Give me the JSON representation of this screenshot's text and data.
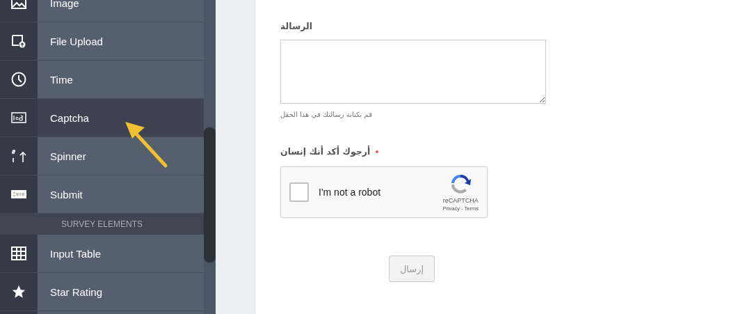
{
  "sidebar": {
    "items": [
      {
        "kind": "element",
        "label": "Image",
        "selected": false
      },
      {
        "kind": "element",
        "label": "File Upload",
        "selected": false
      },
      {
        "kind": "element",
        "label": "Time",
        "selected": false
      },
      {
        "kind": "element",
        "label": "Captcha",
        "selected": true
      },
      {
        "kind": "element",
        "label": "Spinner",
        "selected": false
      },
      {
        "kind": "element",
        "label": "Submit",
        "selected": false
      },
      {
        "kind": "section",
        "label": "SURVEY ELEMENTS"
      },
      {
        "kind": "element",
        "label": "Input Table",
        "selected": false
      },
      {
        "kind": "element",
        "label": "Star Rating",
        "selected": false
      },
      {
        "kind": "element",
        "selected": false
      }
    ]
  },
  "form": {
    "message": {
      "label": "الرسالة",
      "help": "قم بكتابة رسالتك في هذا الحقل"
    },
    "captcha": {
      "label": "أرجوك أكد أنك إنسان",
      "required": true,
      "checked": false,
      "text": "I'm not a robot",
      "brand": "reCAPTCHA",
      "links": "Privacy - Terms"
    },
    "submit": {
      "label": "إرسال",
      "disabled": true
    }
  }
}
